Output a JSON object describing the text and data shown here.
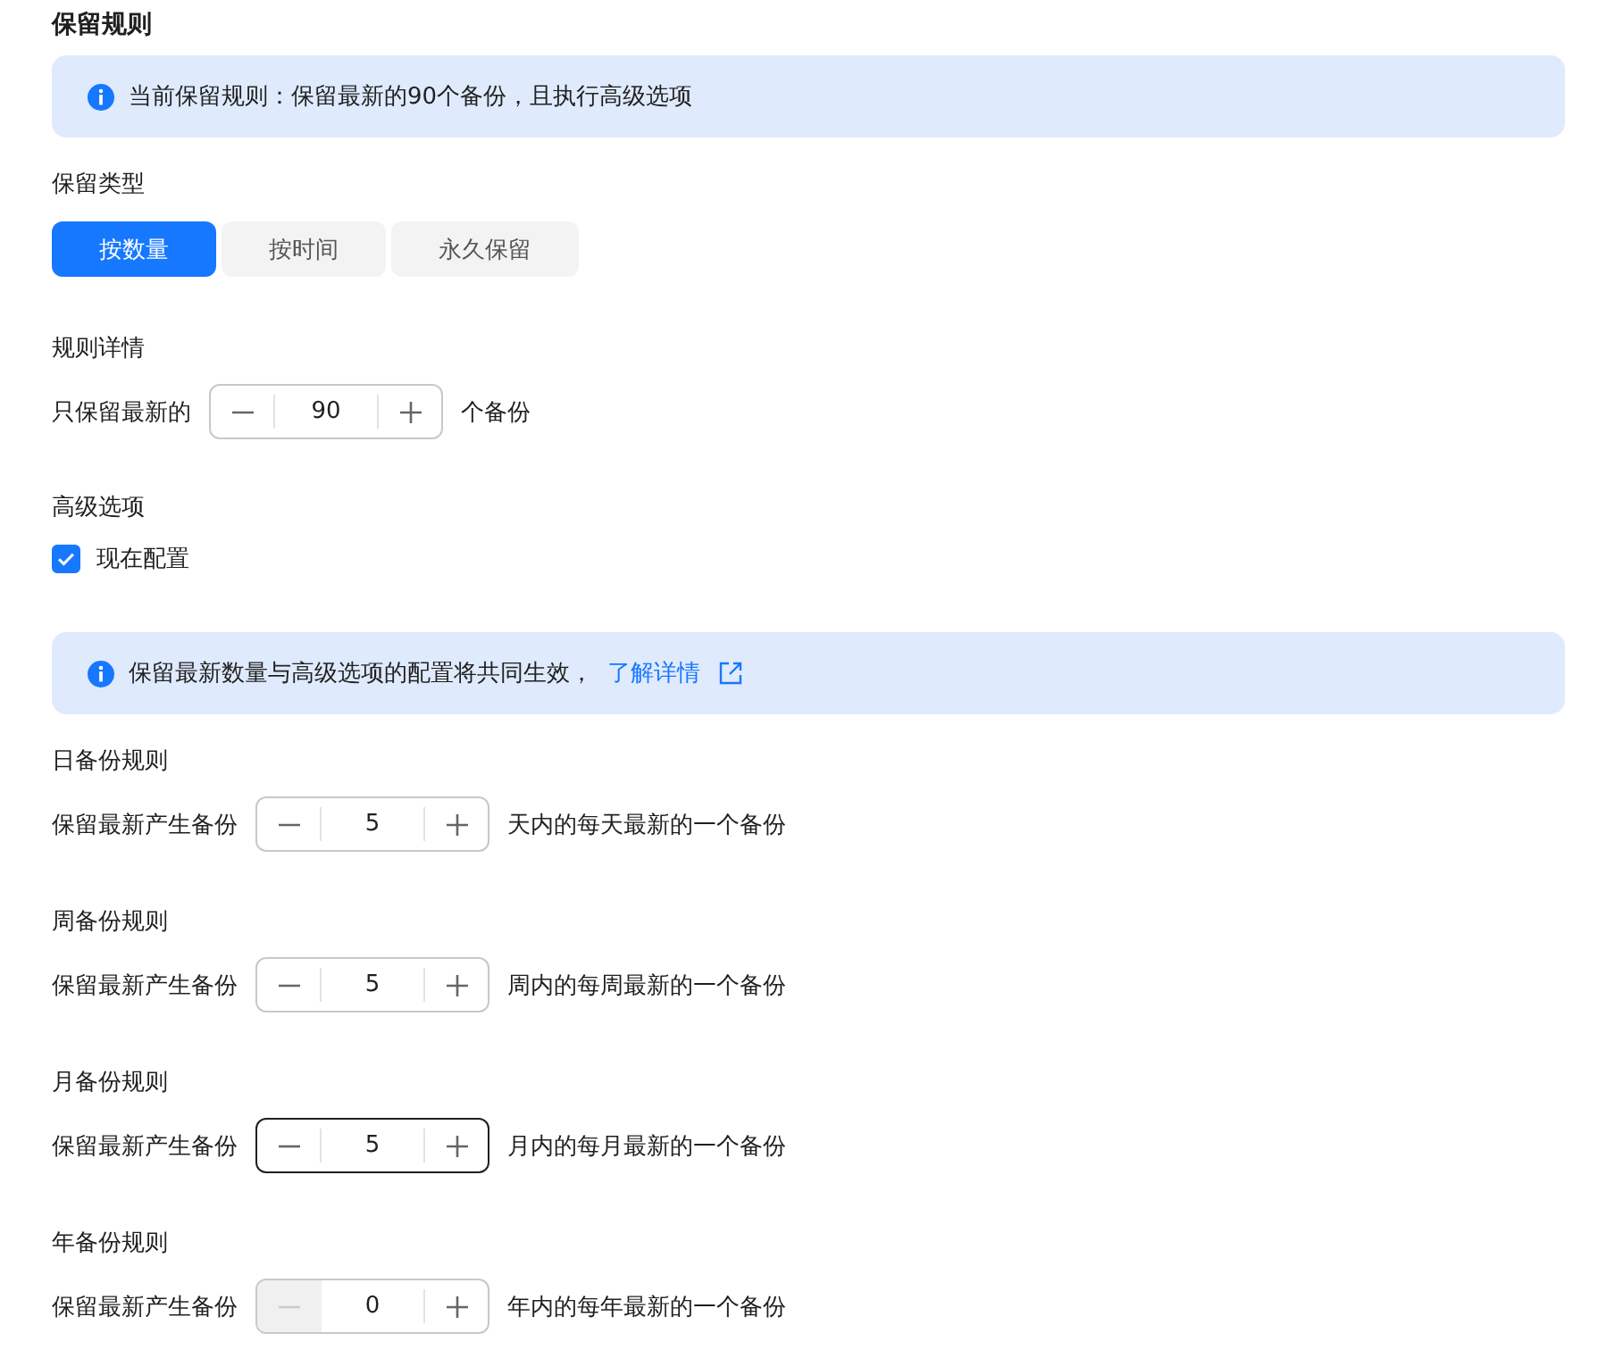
{
  "title": "保留规则",
  "notice": {
    "text": "当前保留规则：保留最新的90个备份，且执行高级选项"
  },
  "retention_type": {
    "label": "保留类型",
    "tabs": [
      {
        "label": "按数量",
        "selected": true
      },
      {
        "label": "按时间",
        "selected": false
      },
      {
        "label": "永久保留",
        "selected": false
      }
    ]
  },
  "rule_details": {
    "label": "规则详情",
    "prefix": "只保留最新的",
    "stepper": {
      "value": "90",
      "focused": false,
      "minus_disabled": false
    },
    "suffix": "个备份"
  },
  "advanced": {
    "label": "高级选项",
    "checkbox": {
      "label": "现在配置",
      "checked": true
    }
  },
  "advanced_notice": {
    "text": "保留最新数量与高级选项的配置将共同生效，",
    "link": "了解详情"
  },
  "rules": [
    {
      "label": "日备份规则",
      "prefix": "保留最新产生备份",
      "stepper": {
        "value": "5",
        "focused": false,
        "minus_disabled": false
      },
      "suffix": "天内的每天最新的一个备份"
    },
    {
      "label": "周备份规则",
      "prefix": "保留最新产生备份",
      "stepper": {
        "value": "5",
        "focused": false,
        "minus_disabled": false
      },
      "suffix": "周内的每周最新的一个备份"
    },
    {
      "label": "月备份规则",
      "prefix": "保留最新产生备份",
      "stepper": {
        "value": "5",
        "focused": true,
        "minus_disabled": false
      },
      "suffix": "月内的每月最新的一个备份"
    },
    {
      "label": "年备份规则",
      "prefix": "保留最新产生备份",
      "stepper": {
        "value": "0",
        "focused": false,
        "minus_disabled": true
      },
      "suffix": "年内的每年最新的一个备份"
    }
  ]
}
